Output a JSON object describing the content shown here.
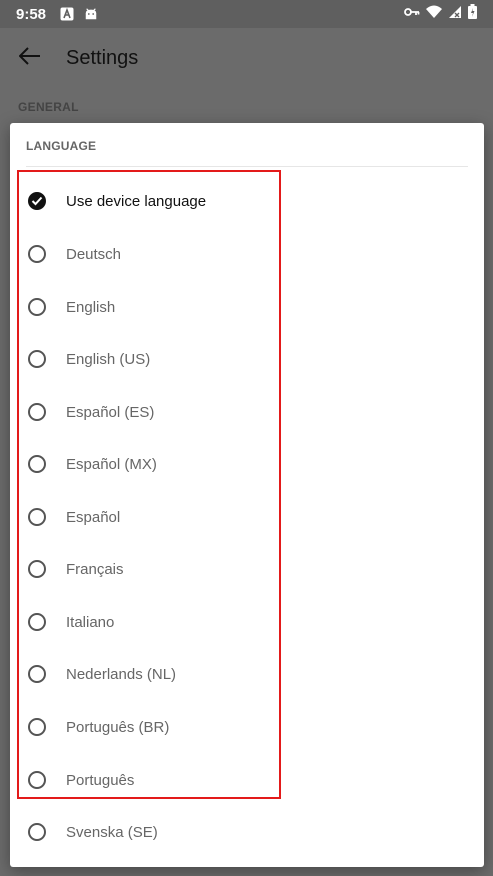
{
  "status_bar": {
    "time": "9:58",
    "icons_left": [
      "a-notification-icon",
      "android-icon"
    ],
    "icons_right": [
      "vpn-key-icon",
      "wifi-icon",
      "signal-icon",
      "battery-icon"
    ]
  },
  "app_bar": {
    "title": "Settings",
    "back_icon": "arrow-back-icon"
  },
  "section": {
    "header": "GENERAL"
  },
  "dialog": {
    "title": "LANGUAGE",
    "options": [
      {
        "label": "Use device language",
        "selected": true
      },
      {
        "label": "Deutsch",
        "selected": false
      },
      {
        "label": "English",
        "selected": false
      },
      {
        "label": "English (US)",
        "selected": false
      },
      {
        "label": "Español (ES)",
        "selected": false
      },
      {
        "label": "Español (MX)",
        "selected": false
      },
      {
        "label": "Español",
        "selected": false
      },
      {
        "label": "Français",
        "selected": false
      },
      {
        "label": "Italiano",
        "selected": false
      },
      {
        "label": "Nederlands (NL)",
        "selected": false
      },
      {
        "label": "Português (BR)",
        "selected": false
      },
      {
        "label": "Português",
        "selected": false
      },
      {
        "label": "Svenska (SE)",
        "selected": false
      }
    ]
  },
  "colors": {
    "highlight": "#e31a1a",
    "scrim": "#6b6b6b",
    "dialog_bg": "#ffffff"
  }
}
